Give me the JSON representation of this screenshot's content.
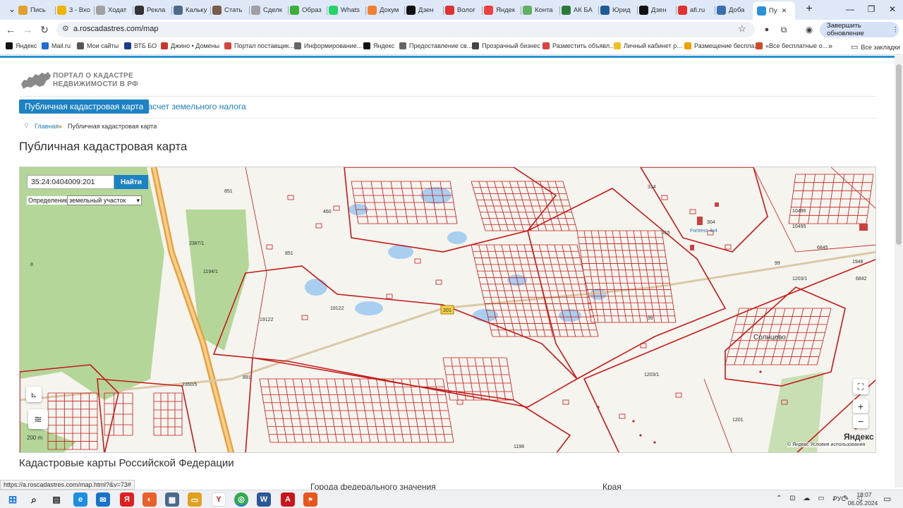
{
  "browser": {
    "tabs": [
      {
        "label": "Пись",
        "color": "#e0a030"
      },
      {
        "label": "3 - Вхо",
        "color": "#f0b400"
      },
      {
        "label": "Ходат",
        "color": "#a0a0a0"
      },
      {
        "label": "Рекла",
        "color": "#333333"
      },
      {
        "label": "Кальку",
        "color": "#4d6a8a"
      },
      {
        "label": "Стать",
        "color": "#7a5c4a"
      },
      {
        "label": "Сделк",
        "color": "#a0a0a0"
      },
      {
        "label": "Образ",
        "color": "#3cae3c"
      },
      {
        "label": "Whats",
        "color": "#25d366"
      },
      {
        "label": "Докум",
        "color": "#f08030"
      },
      {
        "label": "Дзен",
        "color": "#111111"
      },
      {
        "label": "Волог",
        "color": "#e03030"
      },
      {
        "label": "Яндек",
        "color": "#f04040"
      },
      {
        "label": "Конта",
        "color": "#60b060"
      },
      {
        "label": "АК БА",
        "color": "#2a7a3a"
      },
      {
        "label": "Юрид",
        "color": "#1e5b96"
      },
      {
        "label": "Дзен",
        "color": "#111111"
      },
      {
        "label": "afi.ru",
        "color": "#e03030"
      },
      {
        "label": "Доба",
        "color": "#3a6fb0"
      },
      {
        "label": "Пу",
        "color": "#2a92d3",
        "active": true
      }
    ],
    "address": "a.roscadastres.com/map",
    "update_label": "Завершить обновление",
    "bookmarks": [
      {
        "label": "Яндекс",
        "color": "#111111"
      },
      {
        "label": "Mail.ru",
        "color": "#1f6fd1"
      },
      {
        "label": "Мои сайты",
        "color": "#555555"
      },
      {
        "label": "ВТБ БО",
        "color": "#1c3d8c"
      },
      {
        "label": "Джино • Домены",
        "color": "#c0392b"
      },
      {
        "label": "Портал поставщик...",
        "color": "#d4463c"
      },
      {
        "label": "Информирование...",
        "color": "#666666"
      },
      {
        "label": "Яндекс",
        "color": "#111111"
      },
      {
        "label": "Предоставление св...",
        "color": "#666666"
      },
      {
        "label": "Прозрачный бизнес",
        "color": "#444444"
      },
      {
        "label": "Разместить объявл...",
        "color": "#e04040"
      },
      {
        "label": "Личный кабинет р...",
        "color": "#f0c020"
      },
      {
        "label": "Размещение беспла...",
        "color": "#f0a000"
      },
      {
        "label": "«Все бесплатные о...",
        "color": "#d04a2a"
      }
    ],
    "all_bookmarks": "Все закладки",
    "status_url": "https://a.roscadastres.com/map.html?&v=73#"
  },
  "site": {
    "logo_line1": "ПОРТАЛ О КАДАСТРЕ",
    "logo_line2": "НЕДВИЖИМОСТИ В РФ",
    "nav_active": "Публичная кадастровая карта",
    "nav_tax": "Расчет земельного налога",
    "breadcrumb_home": "Главная",
    "breadcrumb_current": "Публичная кадастровая карта",
    "page_title": "Публичная кадастровая карта",
    "section_title": "Кадастровые карты Российской Федерации",
    "col_federal": "Города федерального значения",
    "col_krai": "Края"
  },
  "map": {
    "search_value": "35:24:0404009:201",
    "search_button": "Найти",
    "definition_label": "Определение:",
    "definition_value": "земельный участок",
    "zoom_in": "+",
    "zoom_out": "−",
    "scale_label": "200 m",
    "yandex_label": "Яндекс",
    "attribution": "© Яндекс  Условия использования",
    "place_label": "Солнцево",
    "poi_label": "Fortress 4x4",
    "road_label": "201",
    "parcel_labels": [
      "19122",
      "19122",
      "1194/1",
      "1203/1",
      "1203/1",
      "1201",
      "1198",
      "851",
      "460",
      "8",
      "891",
      "2350/5",
      "10496",
      "10495",
      "6845",
      "1948",
      "6842",
      "99",
      "99",
      "304",
      "314",
      "315",
      "2387/1",
      "851"
    ],
    "colors": {
      "green": "#a8d08a",
      "water": "#a9cff0",
      "parcel": "#c41a1a",
      "road": "#e8a040",
      "bg": "#f6f4ee"
    }
  },
  "taskbar": {
    "lang": "РУС",
    "time": "18:07",
    "date": "06.05.2024"
  }
}
